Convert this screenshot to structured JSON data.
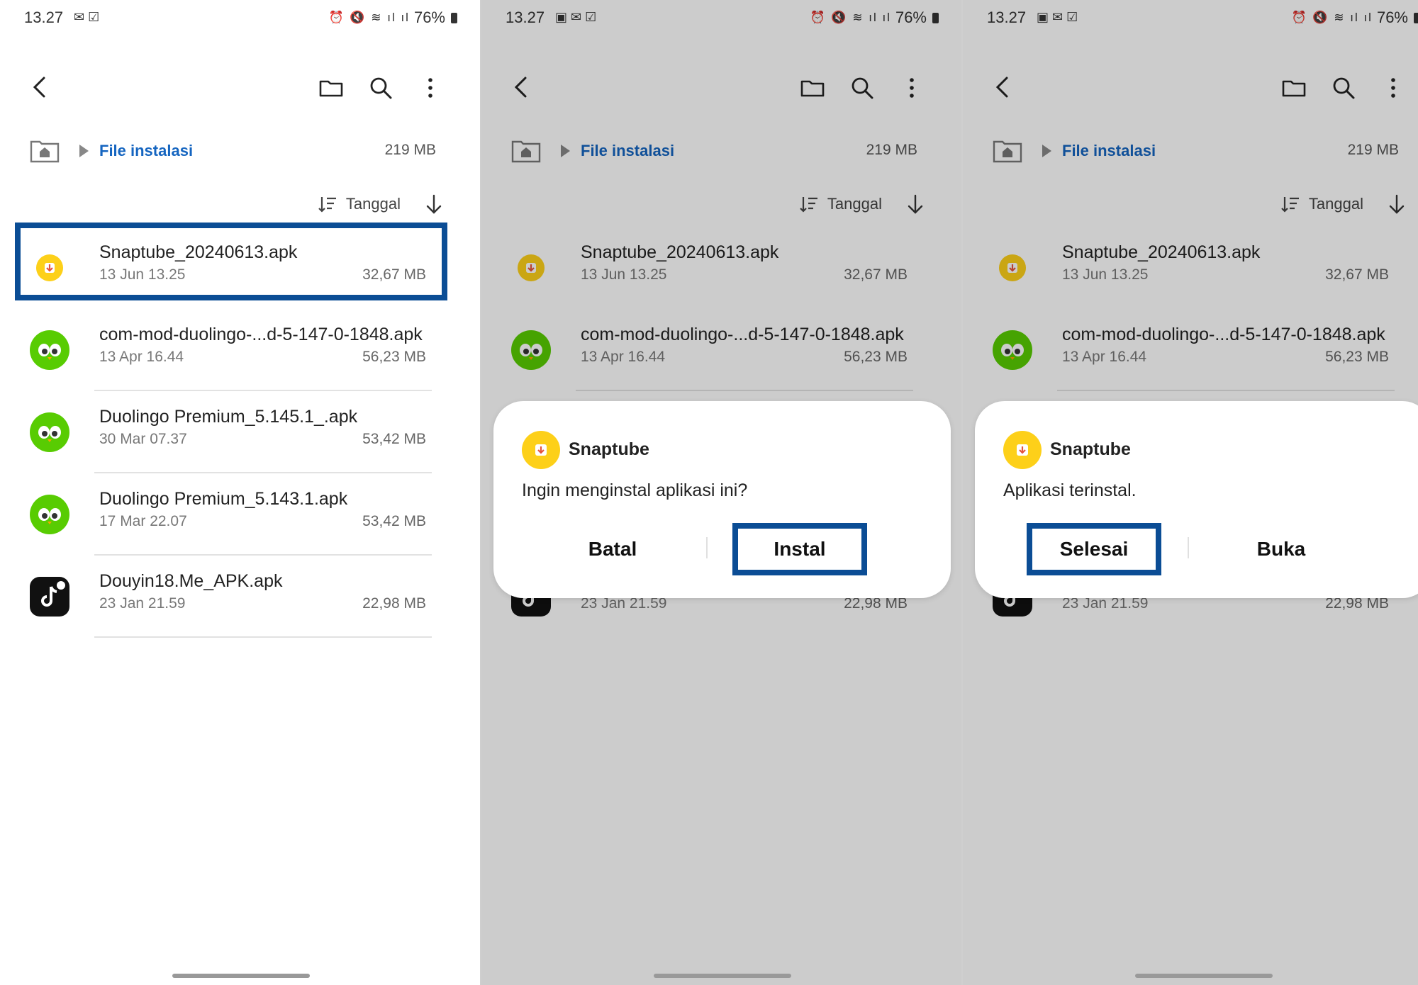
{
  "status": {
    "time": "13.27",
    "battery": "76%"
  },
  "breadcrumb": {
    "path": "File instalasi",
    "size": "219 MB"
  },
  "sort": {
    "label": "Tanggal"
  },
  "files": [
    {
      "name": "Snaptube_20240613.apk",
      "date": "13 Jun 13.25",
      "size": "32,67 MB",
      "icon": "snaptube-icon"
    },
    {
      "name": "com-mod-duolingo-...d-5-147-0-1848.apk",
      "date": "13 Apr 16.44",
      "size": "56,23 MB",
      "icon": "duolingo-icon"
    },
    {
      "name": "Duolingo Premium_5.145.1_.apk",
      "date": "30 Mar 07.37",
      "size": "53,42 MB",
      "icon": "duolingo-icon"
    },
    {
      "name": "Duolingo Premium_5.143.1.apk",
      "date": "17 Mar 22.07",
      "size": "53,42 MB",
      "icon": "duolingo-icon"
    },
    {
      "name": "Douyin18.Me_APK.apk",
      "date": "23 Jan 21.59",
      "size": "22,98 MB",
      "icon": "tiktok-icon"
    }
  ],
  "dialog_install": {
    "app": "Snaptube",
    "message": "Ingin menginstal aplikasi ini?",
    "cancel": "Batal",
    "confirm": "Instal"
  },
  "dialog_done": {
    "app": "Snaptube",
    "message": "Aplikasi terinstal.",
    "done": "Selesai",
    "open": "Buka"
  },
  "colors": {
    "accent": "#1565c0",
    "highlight": "#0b4d95",
    "snaptube": "#fdd019",
    "duolingo": "#58cc02"
  }
}
